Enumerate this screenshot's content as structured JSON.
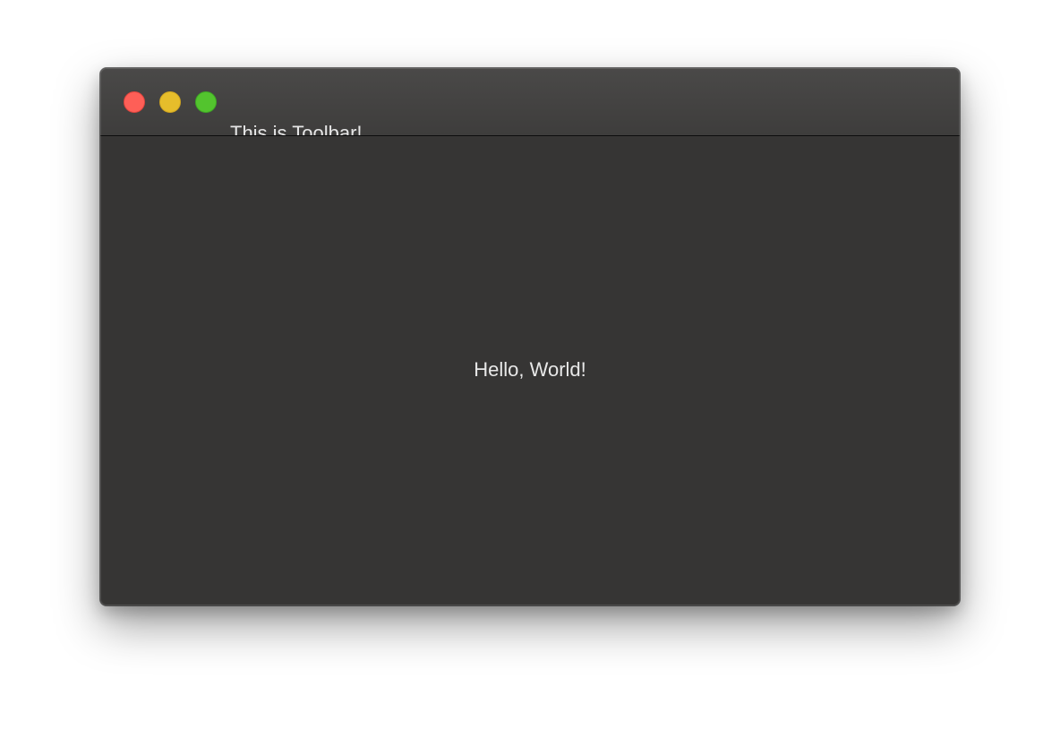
{
  "window": {
    "toolbar_text": "This is Toolbar!",
    "content_text": "Hello, World!"
  },
  "traffic_lights": {
    "close_color": "#fe5f57",
    "minimize_color": "#e6bd2b",
    "zoom_color": "#53c42e"
  }
}
